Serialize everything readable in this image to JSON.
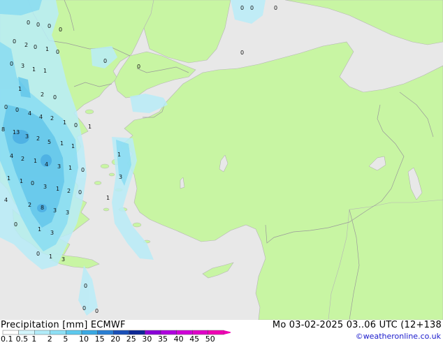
{
  "title": {
    "variable": "Precipitation [mm]",
    "model": "ECMWF",
    "datetime": "Mo 03-02-2025 03..06 UTC (12+138"
  },
  "credit": "©weatheronline.co.uk",
  "colors": {
    "land": "#c8f5a3",
    "sea": "#e8e8e8",
    "border": "#9a9a9a",
    "precip_light": "#b9ecf8",
    "precip_mid": "#86dbf2",
    "precip_heavy": "#5ec3ea"
  },
  "legend": {
    "ticks": [
      "0.1",
      "0.5",
      "1",
      "2",
      "5",
      "10",
      "15",
      "20",
      "25",
      "30",
      "35",
      "40",
      "45",
      "50"
    ],
    "colors": [
      "#fefefe",
      "#d4f6fc",
      "#b2ecf9",
      "#8ee0f5",
      "#5ec9ee",
      "#3aa9e3",
      "#2a7fd3",
      "#1a50b8",
      "#0e2896",
      "#8a00d8",
      "#b000e0",
      "#d000d8",
      "#e000c8",
      "#f000b4"
    ]
  },
  "map_values": [
    {
      "v": "0",
      "c": [
        38,
        35
      ]
    },
    {
      "v": "0",
      "c": [
        52,
        38
      ]
    },
    {
      "v": "0",
      "c": [
        68,
        40
      ]
    },
    {
      "v": "0",
      "c": [
        84,
        45
      ]
    },
    {
      "v": "0",
      "c": [
        18,
        62
      ]
    },
    {
      "v": "2",
      "c": [
        35,
        67
      ]
    },
    {
      "v": "0",
      "c": [
        48,
        70
      ]
    },
    {
      "v": "1",
      "c": [
        65,
        73
      ]
    },
    {
      "v": "0",
      "c": [
        80,
        77
      ]
    },
    {
      "v": "0",
      "c": [
        148,
        90
      ]
    },
    {
      "v": "0",
      "c": [
        14,
        94
      ]
    },
    {
      "v": "3",
      "c": [
        30,
        97
      ]
    },
    {
      "v": "1",
      "c": [
        46,
        102
      ]
    },
    {
      "v": "1",
      "c": [
        62,
        104
      ]
    },
    {
      "v": "0",
      "c": [
        196,
        98
      ]
    },
    {
      "v": "1",
      "c": [
        26,
        130
      ]
    },
    {
      "v": "2",
      "c": [
        58,
        138
      ]
    },
    {
      "v": "0",
      "c": [
        76,
        142
      ]
    },
    {
      "v": "0",
      "c": [
        6,
        156
      ]
    },
    {
      "v": "0",
      "c": [
        22,
        160
      ]
    },
    {
      "v": "4",
      "c": [
        40,
        165
      ]
    },
    {
      "v": "4",
      "c": [
        56,
        170
      ]
    },
    {
      "v": "2",
      "c": [
        72,
        172
      ]
    },
    {
      "v": "1",
      "c": [
        90,
        178
      ]
    },
    {
      "v": "0",
      "c": [
        106,
        182
      ]
    },
    {
      "v": "1",
      "c": [
        126,
        184
      ]
    },
    {
      "v": "8",
      "c": [
        2,
        188
      ]
    },
    {
      "v": "13",
      "c": [
        18,
        192
      ]
    },
    {
      "v": "3",
      "c": [
        36,
        198
      ]
    },
    {
      "v": "2",
      "c": [
        52,
        201
      ]
    },
    {
      "v": "5",
      "c": [
        68,
        206
      ]
    },
    {
      "v": "1",
      "c": [
        86,
        208
      ]
    },
    {
      "v": "1",
      "c": [
        102,
        212
      ]
    },
    {
      "v": "4",
      "c": [
        14,
        226
      ]
    },
    {
      "v": "2",
      "c": [
        30,
        230
      ]
    },
    {
      "v": "1",
      "c": [
        48,
        233
      ]
    },
    {
      "v": "4",
      "c": [
        64,
        238
      ]
    },
    {
      "v": "3",
      "c": [
        82,
        241
      ]
    },
    {
      "v": "1",
      "c": [
        98,
        243
      ]
    },
    {
      "v": "0",
      "c": [
        116,
        246
      ]
    },
    {
      "v": "1",
      "c": [
        10,
        258
      ]
    },
    {
      "v": "1",
      "c": [
        28,
        262
      ]
    },
    {
      "v": "0",
      "c": [
        44,
        265
      ]
    },
    {
      "v": "3",
      "c": [
        62,
        270
      ]
    },
    {
      "v": "1",
      "c": [
        80,
        273
      ]
    },
    {
      "v": "2",
      "c": [
        96,
        276
      ]
    },
    {
      "v": "0",
      "c": [
        112,
        278
      ]
    },
    {
      "v": "4",
      "c": [
        6,
        289
      ]
    },
    {
      "v": "2",
      "c": [
        40,
        296
      ]
    },
    {
      "v": "8",
      "c": [
        58,
        300
      ]
    },
    {
      "v": "3",
      "c": [
        76,
        304
      ]
    },
    {
      "v": "3",
      "c": [
        94,
        307
      ]
    },
    {
      "v": "0",
      "c": [
        20,
        324
      ]
    },
    {
      "v": "1",
      "c": [
        54,
        331
      ]
    },
    {
      "v": "3",
      "c": [
        72,
        336
      ]
    },
    {
      "v": "0",
      "c": [
        52,
        366
      ]
    },
    {
      "v": "1",
      "c": [
        70,
        370
      ]
    },
    {
      "v": "3",
      "c": [
        88,
        374
      ]
    },
    {
      "v": "1",
      "c": [
        168,
        224
      ]
    },
    {
      "v": "3",
      "c": [
        170,
        256
      ]
    },
    {
      "v": "1",
      "c": [
        152,
        286
      ]
    },
    {
      "v": "0",
      "c": [
        120,
        412
      ]
    },
    {
      "v": "0",
      "c": [
        118,
        444
      ]
    },
    {
      "v": "0",
      "c": [
        136,
        448
      ]
    },
    {
      "v": "0",
      "c": [
        344,
        14
      ]
    },
    {
      "v": "0",
      "c": [
        358,
        14
      ]
    },
    {
      "v": "0",
      "c": [
        392,
        14
      ]
    },
    {
      "v": "0",
      "c": [
        344,
        78
      ]
    }
  ]
}
